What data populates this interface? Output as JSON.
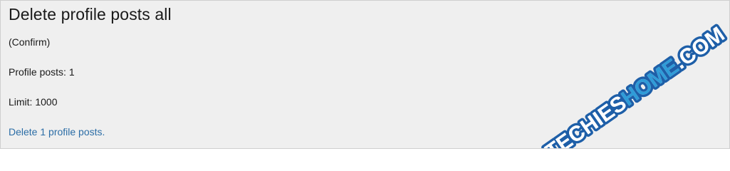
{
  "page": {
    "title": "Delete profile posts all",
    "confirm_note": "(Confirm)",
    "profile_posts_label": "Profile posts: 1",
    "limit_label": "Limit: 1000",
    "delete_link_text": "Delete 1 profile posts."
  },
  "watermark": {
    "text_part1": "TECHIES",
    "text_part2": "HOME",
    "text_part3": ".COM",
    "color_primary": "#1e5fa8",
    "color_accent": "#2f9cd8"
  },
  "colors": {
    "background": "#efefef",
    "border": "#cfcfcf",
    "link": "#2b6da6",
    "text": "#1a1a1a"
  }
}
